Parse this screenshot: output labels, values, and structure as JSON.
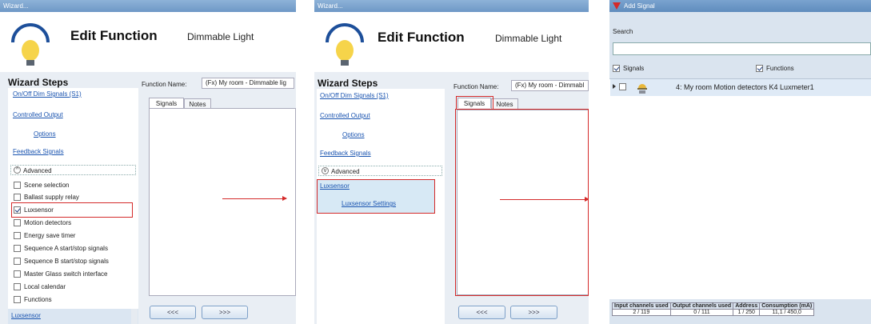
{
  "panel1": {
    "title": "Wizard...",
    "header_title": "Edit Function",
    "header_subtitle": "Dimmable Light",
    "wizard_steps_title": "Wizard Steps",
    "steps": [
      "On/Off Dim Signals (S1)",
      "Controlled Output",
      "Options",
      "Feedback Signals"
    ],
    "advanced_label": "Advanced",
    "advanced_options": [
      {
        "label": "Scene selection",
        "checked": false
      },
      {
        "label": "Ballast supply relay",
        "checked": false
      },
      {
        "label": "Luxsensor",
        "checked": true
      },
      {
        "label": "Motion detectors",
        "checked": false
      },
      {
        "label": "Energy save timer",
        "checked": false
      },
      {
        "label": "Sequence A start/stop signals",
        "checked": false
      },
      {
        "label": "Sequence B start/stop signals",
        "checked": false
      },
      {
        "label": "Master Glass switch interface",
        "checked": false
      },
      {
        "label": "Local calendar",
        "checked": false
      },
      {
        "label": "Functions",
        "checked": false
      }
    ],
    "bottom_link": "Luxsensor",
    "function_name_label": "Function Name:",
    "function_name_value": "(Fx) My room - Dimmable lig",
    "tabs": [
      "Signals",
      "Notes"
    ],
    "prev_button": "<<<",
    "next_button": ">>>"
  },
  "panel2": {
    "title": "Wizard...",
    "header_title": "Edit Function",
    "header_subtitle": "Dimmable Light",
    "wizard_steps_title": "Wizard Steps",
    "steps": [
      "On/Off Dim Signals (S1)",
      "Controlled Output",
      "Options",
      "Feedback Signals"
    ],
    "advanced_label": "Advanced",
    "lux_link": "Luxsensor",
    "lux_settings_link": "Luxsensor Settings",
    "function_name_label": "Function Name:",
    "function_name_value": "(Fx) My room - Dimmabl",
    "tabs": [
      "Signals",
      "Notes"
    ],
    "prev_button": "<<<",
    "next_button": ">>>"
  },
  "panel3": {
    "title": "Add Signal",
    "search_label": "Search",
    "search_value": "",
    "signals_label": "Signals",
    "functions_label": "Functions",
    "item_label": "4: My room Motion detectors K4 Luxmeter1",
    "stats_headers": [
      "Input channels used",
      "Output channels used",
      "Address",
      "Consumption (mA)"
    ],
    "stats_values": [
      "2 / 119",
      "0 / 111",
      "1 / 250",
      "11,1 / 450,0"
    ]
  },
  "colors": {
    "accent_red": "#d42a2a",
    "link_blue": "#1a54b0",
    "titlebar": "#7aa3cf"
  }
}
